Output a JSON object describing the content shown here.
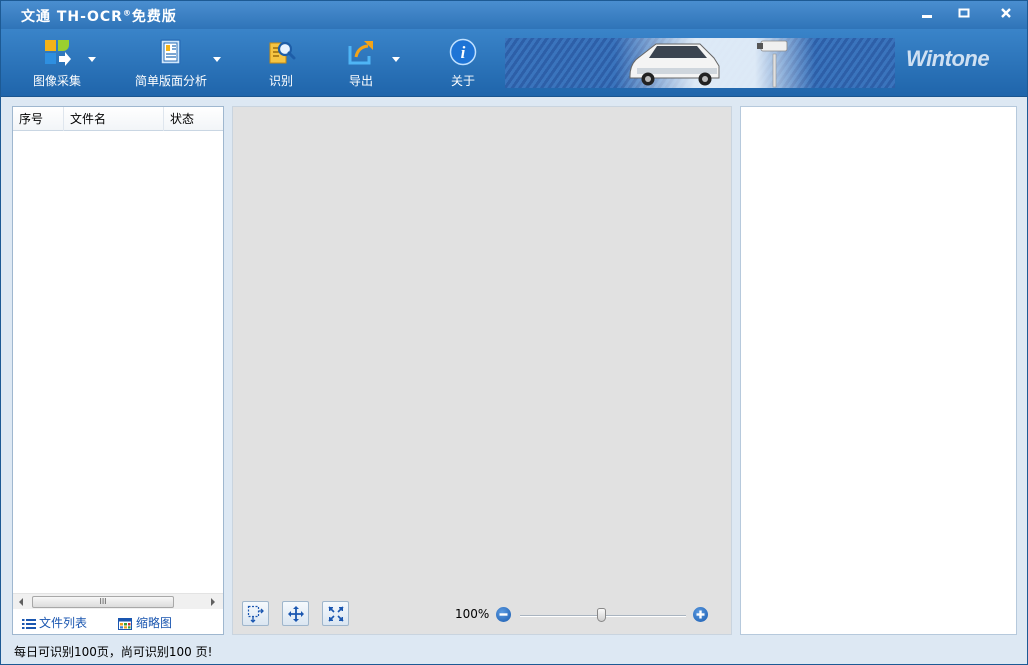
{
  "window": {
    "title": "文通 TH-OCR",
    "title_reg": "®",
    "title_suffix": "免费版",
    "controls": {
      "minimize": "▬",
      "maximize": "▭",
      "close": "✕"
    }
  },
  "toolbar": {
    "items": [
      {
        "label": "图像采集",
        "icon": "image-capture-icon",
        "has_dropdown": true
      },
      {
        "label": "简单版面分析",
        "icon": "layout-analysis-icon",
        "has_dropdown": true
      },
      {
        "label": "识别",
        "icon": "recognize-icon",
        "has_dropdown": false
      },
      {
        "label": "导出",
        "icon": "export-icon",
        "has_dropdown": true
      },
      {
        "label": "关于",
        "icon": "info-icon",
        "has_dropdown": false
      }
    ],
    "brand": "Wintone"
  },
  "file_panel": {
    "columns": [
      "序号",
      "文件名",
      "状态"
    ],
    "rows": [],
    "scroll_grip": "III",
    "tabs": [
      {
        "label": "文件列表",
        "icon": "list-icon"
      },
      {
        "label": "缩略图",
        "icon": "thumbnail-icon"
      }
    ]
  },
  "image_panel": {
    "tools": [
      "select-region-icon",
      "pan-icon",
      "fit-window-icon"
    ],
    "zoom": {
      "label": "100%",
      "value_percent": 100,
      "minus": "−",
      "plus": "+"
    }
  },
  "status": {
    "text": "每日可识别100页，尚可识别100 页!"
  },
  "colors": {
    "titlebar": "#3a84c9",
    "toolbar": "#2a72b8",
    "window_bg": "#dde8f3",
    "image_area": "#e1e1e1",
    "link": "#1a56b0"
  }
}
